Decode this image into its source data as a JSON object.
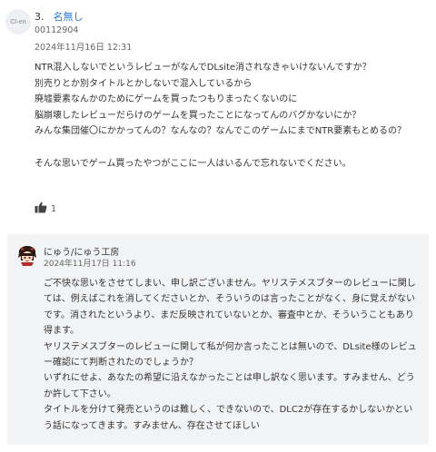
{
  "comment": {
    "avatar_text": "CI-en",
    "number": "3.",
    "author": "名無し",
    "user_id": "00112904",
    "date": "2024年11月16日 12:31",
    "body_lines": [
      "NTR混入しないでというレビューがなんでDLsite消されなきゃいけないんですか？",
      "別売りとか別タイトルとかしないで混入しているから",
      "廃墟要素なんかのためにゲームを買ったつもりまったくないのに",
      "脳崩壊したレビューだらけのゲームを買ったことになってんのバグかないにか？",
      "みんな集団催〇にかかってんの？なんなの？なんでこのゲームにまでNTR要素もとめるの？",
      "",
      "そんな思いでゲーム買ったやつがここに一人はいるんで忘れないでください。"
    ],
    "like_icon": "thumbs-up-icon",
    "like_count": "1"
  },
  "reply": {
    "avatar_icon": "creator-avatar",
    "author": "にゅう/にゅう工房",
    "date": "2024年11月17日 11:16",
    "body_lines": [
      "ご不快な思いをさせてしまい、申し訳ございません。ヤリステメスブターのレビューに関しては、例えばこれを消してくださいとか、そういうのは言ったことがなく、身に覚えがないです。消されたというより、まだ反映されていないとか、審査中とか、そういうこともあり得ます。",
      "ヤリステメスブターのレビューに関して私が何か言ったことは無いので、DLsite様のレビュー確認にて判断されたのでしょうか？",
      "いずれにせよ、あなたの希望に沿えなかったことは申し訳なく思います。すみません、どうか許して下さい。",
      "タイトルを分けて発売というのは難しく、できないので、DLC2が存在するかしないかという話になってきます。すみません、存在させてほしい"
    ]
  },
  "colors": {
    "link": "#2c7bd6",
    "reply_bg": "#f2f3f5",
    "text": "#333333"
  }
}
